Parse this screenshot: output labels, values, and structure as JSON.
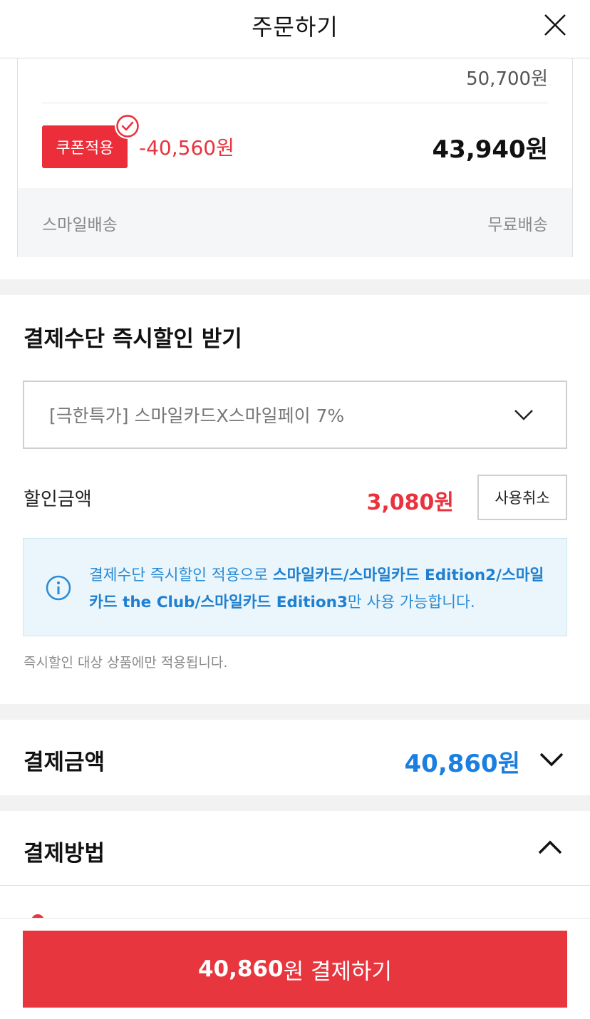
{
  "header": {
    "title": "주문하기",
    "close_icon": "close-icon"
  },
  "product": {
    "original_price": "50,700원",
    "coupon_label": "쿠폰적용",
    "coupon_discount": "-40,560원",
    "final_price": "43,940원",
    "shipping_label": "스마일배송",
    "shipping_value": "무료배송"
  },
  "instant_discount": {
    "title": "결제수단 즉시할인 받기",
    "selected_option": "[극한특가] 스마일카드X스마일페이 7%",
    "discount_label": "할인금액",
    "discount_amount": "3,080원",
    "cancel_label": "사용취소",
    "info_prefix": "결제수단 즉시할인 적용으로 ",
    "info_cards": "스마일카드/스마일카드 Edition2/스마일카드 the Club/스마일카드 Edition3",
    "info_suffix": "만 사용 가능합니다.",
    "footnote": "즉시할인 대상 상품에만 적용됩니다."
  },
  "payment_amount": {
    "title": "결제금액",
    "amount": "40,860원"
  },
  "payment_method": {
    "title": "결제방법"
  },
  "pay_button": {
    "amount": "40,860",
    "suffix": "원 결제하기"
  },
  "colors": {
    "accent_red": "#e8363f",
    "accent_blue": "#1a7fe0",
    "info_bg": "#eaf6fb"
  }
}
